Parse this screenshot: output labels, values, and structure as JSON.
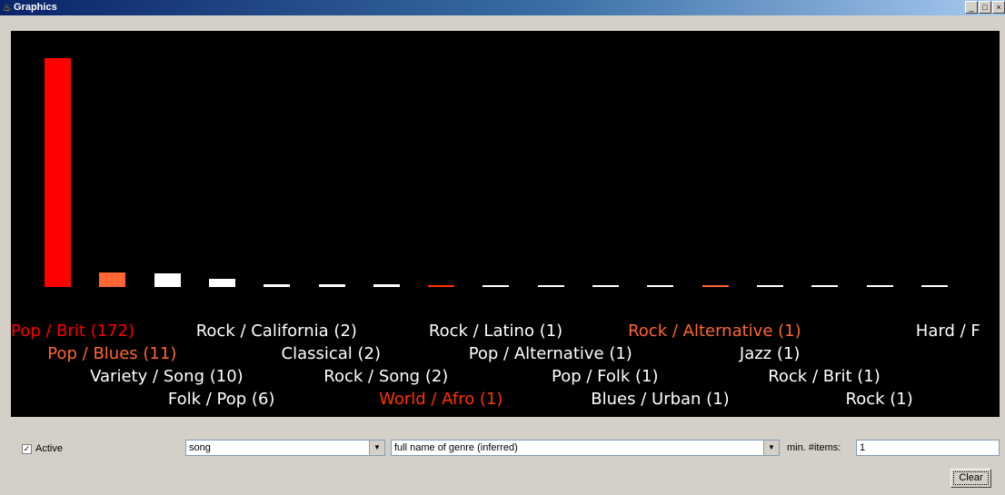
{
  "window": {
    "title": "Graphics",
    "buttons": [
      "_",
      "□",
      "×"
    ]
  },
  "chart_data": {
    "type": "bar",
    "colors": {
      "highlight": "#ff0000",
      "secondary": "#ff6633",
      "normal": "#ffffff"
    },
    "categories": [
      {
        "label": "Pop / Brit (172)",
        "value": 172,
        "color": "#ff0000"
      },
      {
        "label": "Pop / Blues (11)",
        "value": 11,
        "color": "#ff6633"
      },
      {
        "label": "Variety / Song (10)",
        "value": 10,
        "color": "#ffffff"
      },
      {
        "label": "Folk / Pop (6)",
        "value": 6,
        "color": "#ffffff"
      },
      {
        "label": "Rock / California (2)",
        "value": 2,
        "color": "#ffffff"
      },
      {
        "label": "Classical (2)",
        "value": 2,
        "color": "#ffffff"
      },
      {
        "label": "Rock / Song (2)",
        "value": 2,
        "color": "#ffffff"
      },
      {
        "label": "World / Afro (1)",
        "value": 1,
        "color": "#ff3300"
      },
      {
        "label": "Rock / Latino (1)",
        "value": 1,
        "color": "#ffffff"
      },
      {
        "label": "Pop / Alternative (1)",
        "value": 1,
        "color": "#ffffff"
      },
      {
        "label": "Pop / Folk (1)",
        "value": 1,
        "color": "#ffffff"
      },
      {
        "label": "Blues / Urban (1)",
        "value": 1,
        "color": "#ffffff"
      },
      {
        "label": "Rock / Alternative (1)",
        "value": 1,
        "color": "#ff6633"
      },
      {
        "label": "Jazz (1)",
        "value": 1,
        "color": "#ffffff"
      },
      {
        "label": "Rock / Brit (1)",
        "value": 1,
        "color": "#ffffff"
      },
      {
        "label": "Rock (1)",
        "value": 1,
        "color": "#ffffff"
      },
      {
        "label": "Hard / F",
        "value": 1,
        "color": "#ffffff"
      }
    ]
  },
  "controls": {
    "active_label": "Active",
    "active_checked": "☑",
    "item_select": "song",
    "genre_select": "full name of genre (inferred)",
    "min_items_label": "min. #items:",
    "min_items_value": "1",
    "clear_label": "Clear"
  }
}
